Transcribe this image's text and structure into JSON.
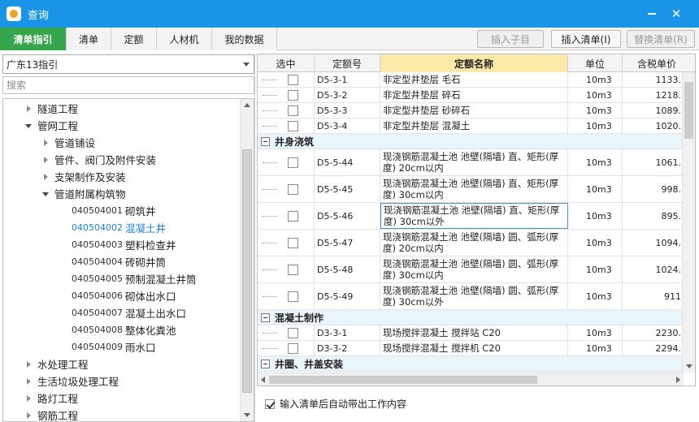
{
  "window": {
    "title": "查询",
    "close": "✕"
  },
  "tabs": [
    {
      "label": "清单指引",
      "active": true
    },
    {
      "label": "清单"
    },
    {
      "label": "定额"
    },
    {
      "label": "人材机"
    },
    {
      "label": "我的数据"
    }
  ],
  "toolbar": {
    "insert_child": "插入子目",
    "insert_list": "插入清单(I)",
    "replace_list": "替换清单(R)"
  },
  "left": {
    "combo_value": "广东13指引",
    "search_placeholder": "搜索",
    "tree": [
      {
        "label": "隧道工程",
        "type": "collapsed"
      },
      {
        "label": "管网工程",
        "type": "expanded"
      },
      {
        "label": "管道铺设",
        "type": "collapsed"
      },
      {
        "label": "管件、阀门及附件安装",
        "type": "collapsed"
      },
      {
        "label": "支架制作及安装",
        "type": "collapsed"
      },
      {
        "label": "管道附属构筑物",
        "type": "expanded"
      },
      {
        "code": "040504001",
        "label": "砌筑井"
      },
      {
        "code": "040504002",
        "label": "混凝土井",
        "selected": true
      },
      {
        "code": "040504003",
        "label": "塑料检查井"
      },
      {
        "code": "040504004",
        "label": "砖砌井筒"
      },
      {
        "code": "040504005",
        "label": "预制混凝土井筒"
      },
      {
        "code": "040504006",
        "label": "砌体出水口"
      },
      {
        "code": "040504007",
        "label": "混凝土出水口"
      },
      {
        "code": "040504008",
        "label": "整体化粪池"
      },
      {
        "code": "040504009",
        "label": "雨水口"
      },
      {
        "label": "水处理工程",
        "type": "collapsed"
      },
      {
        "label": "生活垃圾处理工程",
        "type": "collapsed"
      },
      {
        "label": "路灯工程",
        "type": "collapsed"
      },
      {
        "label": "钢筋工程",
        "type": "collapsed"
      }
    ]
  },
  "grid": {
    "headers": [
      "选中",
      "定额号",
      "定额名称",
      "单位",
      "含税单价"
    ],
    "rows": [
      {
        "code": "D5-3-1",
        "name": "非定型井垫层 毛石",
        "unit": "10m3",
        "price": "1133."
      },
      {
        "code": "D5-3-2",
        "name": "非定型井垫层 碎石",
        "unit": "10m3",
        "price": "1218."
      },
      {
        "code": "D5-3-3",
        "name": "非定型井垫层 砂碎石",
        "unit": "10m3",
        "price": "1089."
      },
      {
        "code": "D5-3-4",
        "name": "非定型井垫层 混凝土",
        "unit": "10m3",
        "price": "1020."
      },
      {
        "group": "井身浇筑"
      },
      {
        "code": "D5-5-44",
        "name": "现浇钢筋混凝土池 池壁(隔墙) 直、矩形(厚度) 20cm以内",
        "unit": "10m3",
        "price": "1061."
      },
      {
        "code": "D5-5-45",
        "name": "现浇钢筋混凝土池 池壁(隔墙) 直、矩形(厚度) 30cm以内",
        "unit": "10m3",
        "price": "998."
      },
      {
        "code": "D5-5-46",
        "name": "现浇钢筋混凝土池 池壁(隔墙) 直、矩形(厚度) 30cm以外",
        "unit": "10m3",
        "price": "895.",
        "focused": true
      },
      {
        "code": "D5-5-47",
        "name": "现浇钢筋混凝土池 池壁(隔墙) 圆、弧形(厚度) 20cm以内",
        "unit": "10m3",
        "price": "1094."
      },
      {
        "code": "D5-5-48",
        "name": "现浇钢筋混凝土池 池壁(隔墙) 圆、弧形(厚度) 30cm以内",
        "unit": "10m3",
        "price": "1024."
      },
      {
        "code": "D5-5-49",
        "name": "现浇钢筋混凝土池 池壁(隔墙) 圆、弧形(厚度) 30cm以外",
        "unit": "10m3",
        "price": "911"
      },
      {
        "group": "混凝土制作"
      },
      {
        "code": "D3-3-1",
        "name": "现场搅拌混凝土 搅拌站 C20",
        "unit": "10m3",
        "price": "2230."
      },
      {
        "code": "D3-3-2",
        "name": "现场搅拌混凝土 搅拌机 C20",
        "unit": "10m3",
        "price": "2294."
      },
      {
        "group": "井圈、井盖安装"
      }
    ]
  },
  "bottom": {
    "auto_work_label": "输入清单后自动带出工作内容",
    "checked": true
  }
}
